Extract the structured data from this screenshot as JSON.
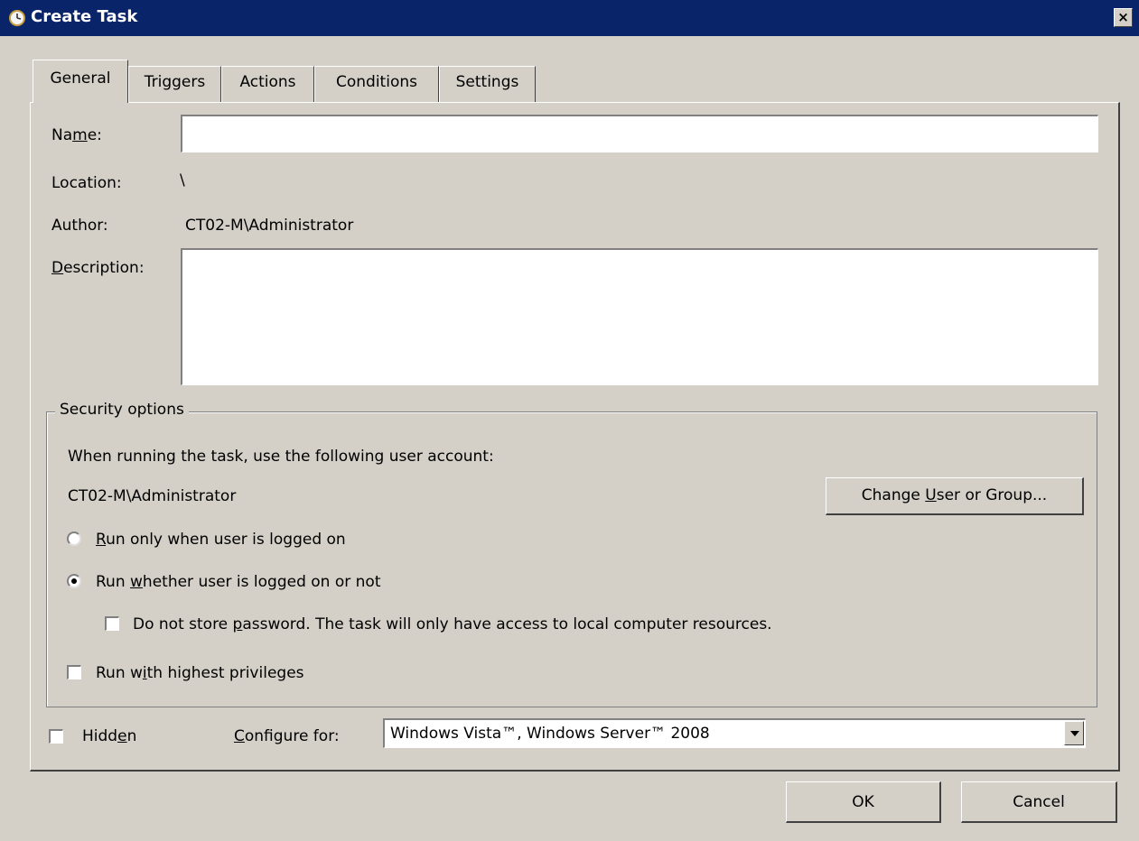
{
  "window": {
    "title": "Create Task",
    "icon": "task-clock-icon",
    "close_glyph": "×"
  },
  "tabs": [
    {
      "label": "General",
      "active": true
    },
    {
      "label": "Triggers",
      "active": false
    },
    {
      "label": "Actions",
      "active": false
    },
    {
      "label": "Conditions",
      "active": false
    },
    {
      "label": "Settings",
      "active": false
    }
  ],
  "general": {
    "name_label_pre": "Na",
    "name_label_u": "m",
    "name_label_post": "e:",
    "name_value": "",
    "location_label": "Location:",
    "location_value": "\\",
    "author_label": "Author:",
    "author_value": "CT02-M\\Administrator",
    "description_label_u": "D",
    "description_label_post": "escription:",
    "description_value": ""
  },
  "security": {
    "legend": "Security options",
    "account_prompt": "When running the task, use the following user account:",
    "account_value": "CT02-M\\Administrator",
    "change_button_pre": "Change ",
    "change_button_u": "U",
    "change_button_post": "ser or Group...",
    "radio_logged_on_u": "R",
    "radio_logged_on_post": "un only when user is logged on",
    "radio_logged_on_selected": false,
    "radio_whether_pre": "Run ",
    "radio_whether_u": "w",
    "radio_whether_post": "hether user is logged on or not",
    "radio_whether_selected": true,
    "no_store_pre": "Do not store ",
    "no_store_u": "p",
    "no_store_post": "assword.  The task will only have access to local computer resources.",
    "no_store_checked": false,
    "highest_pre": "Run w",
    "highest_u": "i",
    "highest_post": "th highest privileges",
    "highest_checked": false
  },
  "bottom": {
    "hidden_pre": "Hidd",
    "hidden_u": "e",
    "hidden_post": "n",
    "hidden_checked": false,
    "configure_u": "C",
    "configure_post": "onfigure for:",
    "configure_value": "Windows Vista™, Windows Server™ 2008"
  },
  "buttons": {
    "ok": "OK",
    "cancel": "Cancel"
  }
}
